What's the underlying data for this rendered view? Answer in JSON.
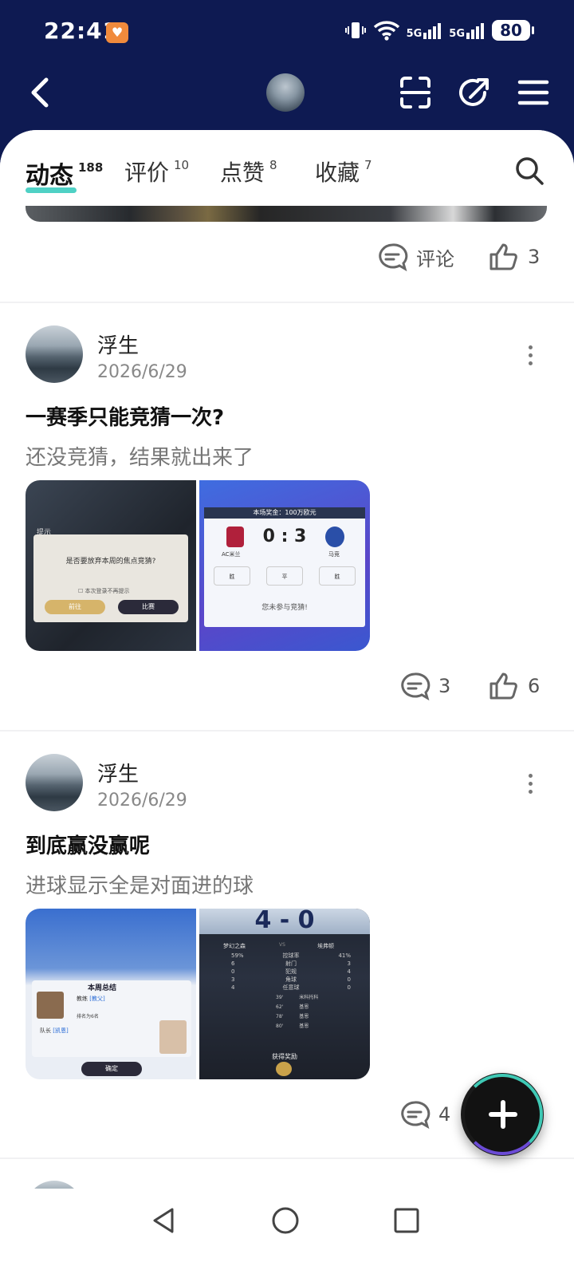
{
  "status_bar": {
    "time": "22:41",
    "network1": "5G",
    "network2": "5G",
    "battery": "80"
  },
  "tabs": [
    {
      "label": "动态",
      "count": "188"
    },
    {
      "label": "评价",
      "count": "10"
    },
    {
      "label": "点赞",
      "count": "8"
    },
    {
      "label": "收藏",
      "count": "7"
    }
  ],
  "first_post_actions": {
    "comment_label": "评论",
    "like_count": "3"
  },
  "posts": [
    {
      "author": "浮生",
      "date": "2026/6/29",
      "title": "一赛季只能竞猜一次?",
      "body": "还没竞猜，结果就出来了",
      "comment_count": "3",
      "like_count": "6",
      "image1": {
        "hint": "提示",
        "question": "是否要放弃本周的焦点竞猜?",
        "checkbox": "本次登录不再提示",
        "btn_left": "前往",
        "btn_right": "比赛"
      },
      "image2": {
        "prize": "本场奖金：100万欧元",
        "score": "0 : 3",
        "team_left": "AC米兰",
        "team_right": "马竞",
        "opt_win_left": "胜",
        "opt_draw": "平",
        "opt_win_right": "胜",
        "notice": "您未参与竞猜!"
      }
    },
    {
      "author": "浮生",
      "date": "2026/6/29",
      "title": "到底赢没赢呢",
      "body": "进球显示全是对面进的球",
      "comment_count": "4",
      "like_count": "",
      "image1": {
        "header": "本周总结",
        "coach_label": "教练",
        "coach_name": "[教父]",
        "captain_label": "队长",
        "captain_name": "[凯恩]",
        "confirm": "确定",
        "ranking": "排名为6名"
      },
      "image2": {
        "score": "4 - 0",
        "team_left": "梦幻之森",
        "vs": "VS",
        "team_right": "埃弗顿",
        "stats": [
          {
            "l": "59%",
            "k": "控球率",
            "r": "41%"
          },
          {
            "l": "6",
            "k": "射门",
            "r": "3"
          },
          {
            "l": "0",
            "k": "犯规",
            "r": "4"
          },
          {
            "l": "3",
            "k": "角球",
            "r": "0"
          },
          {
            "l": "4",
            "k": "任意球",
            "r": "0"
          }
        ],
        "goals": [
          {
            "t": "39'",
            "n": "米科托科"
          },
          {
            "t": "62'",
            "n": "基恩"
          },
          {
            "t": "78'",
            "n": "基恩"
          },
          {
            "t": "80'",
            "n": "基恩"
          }
        ],
        "reward": "获得奖励"
      }
    }
  ],
  "colors": {
    "header_bg": "#0e1a52",
    "tab_underline": "#4fd1c5",
    "fab_bg": "#121212"
  }
}
